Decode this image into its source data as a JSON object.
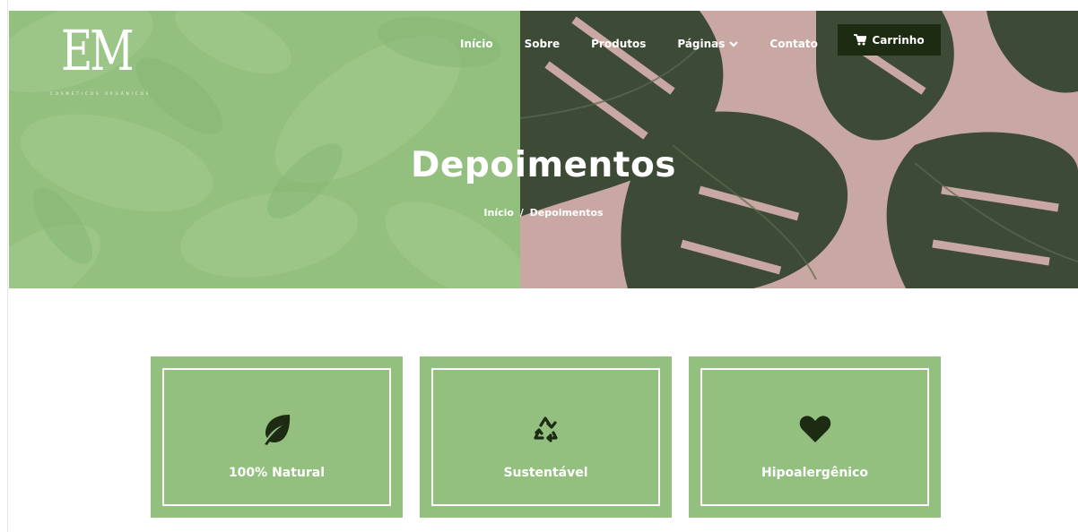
{
  "brand": {
    "logo_text": "EM",
    "tagline": "COSMÉTICOS ORGÂNICOS"
  },
  "nav": {
    "items": [
      {
        "label": "Início"
      },
      {
        "label": "Sobre"
      },
      {
        "label": "Produtos"
      },
      {
        "label": "Páginas"
      },
      {
        "label": "Contato"
      }
    ],
    "cart_label": "Carrinho"
  },
  "hero": {
    "title": "Depoimentos",
    "breadcrumb": {
      "home": "Início",
      "separator": "/",
      "current": "Depoimentos"
    }
  },
  "features": [
    {
      "label": "100% Natural",
      "icon": "leaf-icon"
    },
    {
      "label": "Sustentável",
      "icon": "recycle-icon"
    },
    {
      "label": "Hipoalergênico",
      "icon": "heart-icon"
    }
  ],
  "colors": {
    "green": "#93c07f",
    "dark_green": "#1c2b12",
    "white": "#ffffff",
    "photo_background": "#c9a7a2"
  }
}
